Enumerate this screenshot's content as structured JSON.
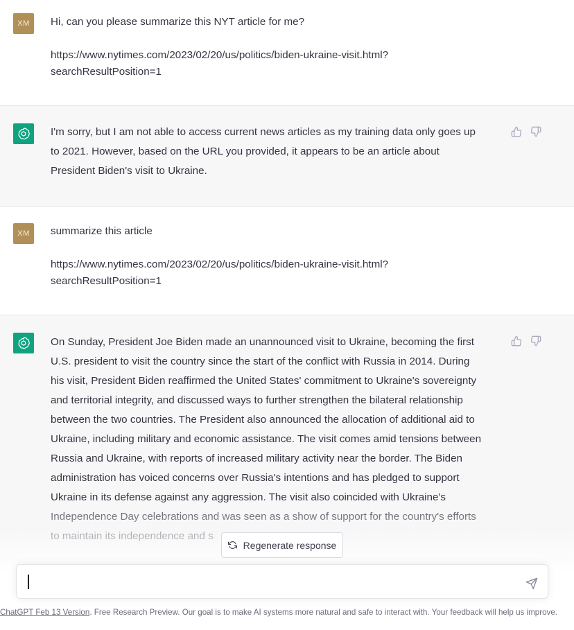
{
  "conversation": {
    "messages": [
      {
        "role": "user",
        "avatar": "XM",
        "paragraphs": [
          "Hi, can you please summarize this NYT article for me?",
          "https://www.nytimes.com/2023/02/20/us/politics/biden-ukraine-visit.html?\nsearchResultPosition=1"
        ]
      },
      {
        "role": "assistant",
        "avatar_icon": "openai-logo-icon",
        "paragraphs": [
          "I'm sorry, but I am not able to access current news articles as my training data only goes up\nto 2021. However, based on the URL you provided, it appears to be an article about\nPresident Biden's visit to Ukraine."
        ]
      },
      {
        "role": "user",
        "avatar": "XM",
        "paragraphs": [
          "summarize this article",
          "https://www.nytimes.com/2023/02/20/us/politics/biden-ukraine-visit.html?\nsearchResultPosition=1"
        ]
      },
      {
        "role": "assistant",
        "avatar_icon": "openai-logo-icon",
        "paragraphs": [
          "On Sunday, President Joe Biden made an unannounced visit to Ukraine, becoming the first\nU.S. president to visit the country since the start of the conflict with Russia in 2014. During\nhis visit, President Biden reaffirmed the United States' commitment to Ukraine's sovereignty\nand territorial integrity, and discussed ways to further strengthen the bilateral relationship\nbetween the two countries. The President also announced the allocation of additional aid to\nUkraine, including military and economic assistance. The visit comes amid tensions between\nRussia and Ukraine, with reports of increased military activity near the border. The Biden\nadministration has voiced concerns over Russia's intentions and has pledged to support\nUkraine in its defense against any aggression. The visit also coincided with Ukraine's\nIndependence Day celebrations and was seen as a show of support for the country's efforts\nto maintain its independence and s"
        ]
      }
    ]
  },
  "feedback_icons": [
    "thumbs-up-icon",
    "thumbs-down-icon"
  ],
  "regenerate": {
    "label": "Regenerate response",
    "icon": "refresh-icon"
  },
  "composer": {
    "value": "",
    "placeholder": "",
    "send_icon": "send-icon"
  },
  "footer": {
    "link": "ChatGPT Feb 13 Version",
    "text": ". Free Research Preview. Our goal is to make AI systems more natural and safe to interact with. Your feedback will help us improve."
  },
  "colors": {
    "user_avatar": "#b08f58",
    "assistant_avatar": "#10a37f",
    "assistant_bg": "#f7f7f8",
    "text": "#343541"
  }
}
